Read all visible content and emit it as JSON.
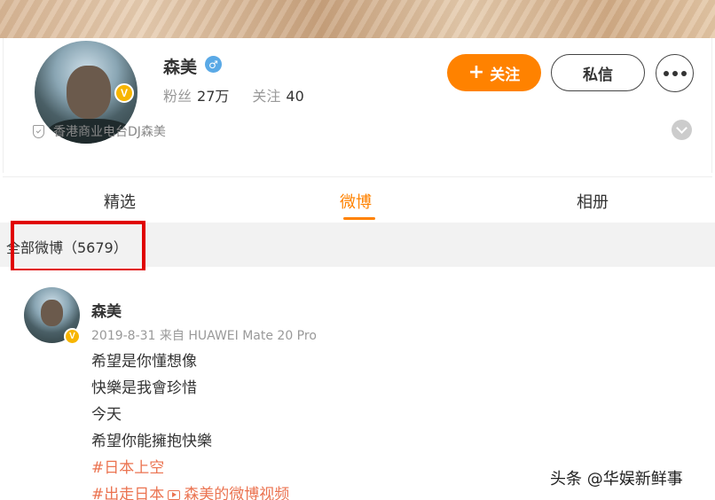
{
  "profile": {
    "name": "森美",
    "gender_symbol": "♂",
    "verified_badge": "V",
    "followers_label": "粉丝",
    "followers_count": "27万",
    "following_label": "关注",
    "following_count": "40",
    "verification_text": "香港商业电台DJ森美",
    "follow_button": "关注",
    "follow_plus": "+",
    "message_button": "私信"
  },
  "tabs": [
    {
      "label": "精选"
    },
    {
      "label": "微博"
    },
    {
      "label": "相册"
    }
  ],
  "section": {
    "title": "全部微博（5679）"
  },
  "post": {
    "author": "森美",
    "meta": "2019-8-31  来自 HUAWEI Mate 20 Pro",
    "lines": [
      "希望是你懂想像",
      "快樂是我會珍惜",
      "今天",
      "希望你能擁抱快樂"
    ],
    "hashtag1": "#日本上空",
    "hashtag2": "#出走日本",
    "video_link": "森美的微博视频"
  },
  "watermark": "头条 @华娱新鲜事",
  "colors": {
    "accent": "#ff8200",
    "link": "#eb7350",
    "verified": "#f7b500",
    "highlight": "#e00000"
  }
}
